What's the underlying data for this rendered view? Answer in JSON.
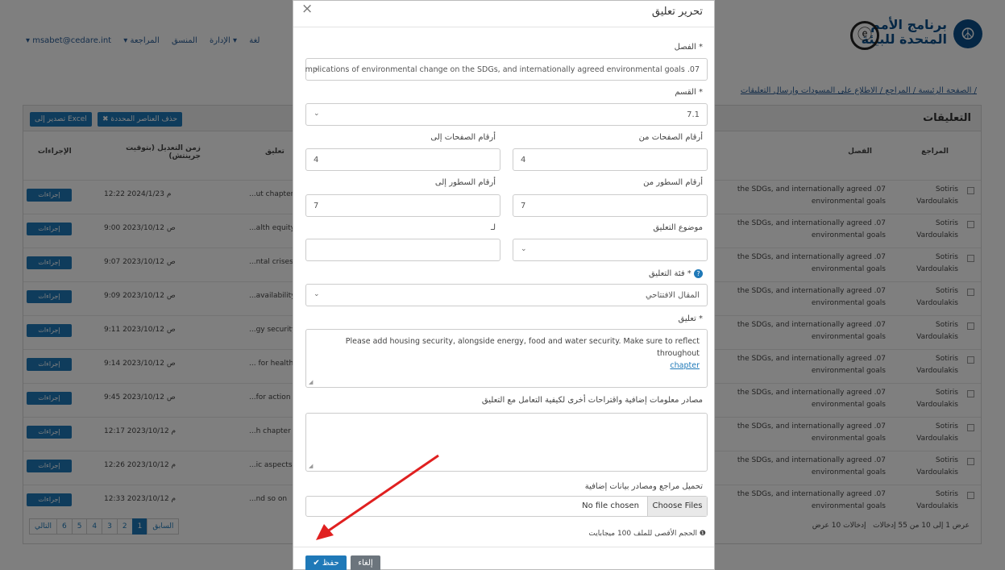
{
  "header": {
    "logo_line1": "برنامج الأمم",
    "logo_line2": "المتحدة للبيئة",
    "user_email": "▾ msabet@cedare.int",
    "nav_items": [
      "▾ لغة",
      "▾ الإدارة",
      "المنسق",
      "المراجعة"
    ],
    "breadcrumb": "الصفحة الرئيسة / المراجع / الاطلاع على المسودات وإرسال التعليقات /"
  },
  "comments_panel": {
    "title": "التعليقات",
    "export_label": "تصدير إلى Excel",
    "delete_selected_label": "✖ حذف العناصر المحددة",
    "col_actions": "الإجراءات",
    "col_modified": "زمن التعديل (بتوقيت جرينتش)",
    "col_comment": "تعليق",
    "col_chapter": "الفصل",
    "col_reviewer": "المراجع",
    "action_label": "إجراءات",
    "rows": [
      {
        "date": "12:22 2024/1/23 م",
        "comment": "...ut chapter",
        "chapter": "the SDGs, and internationally agreed .07 environmental goals",
        "reviewer": "Sotiris Vardoulakis"
      },
      {
        "date": "9:00 2023/10/12 ص",
        "comment": "...alth equity",
        "chapter": "the SDGs, and internationally agreed .07 environmental goals",
        "reviewer": "Sotiris Vardoulakis"
      },
      {
        "date": "9:07 2023/10/12 ص",
        "comment": "...ntal crises",
        "chapter": "the SDGs, and internationally agreed .07 environmental goals",
        "reviewer": "Sotiris Vardoulakis"
      },
      {
        "date": "9:09 2023/10/12 ص",
        "comment": "...availability",
        "chapter": "the SDGs, and internationally agreed .07 environmental goals",
        "reviewer": "Sotiris Vardoulakis"
      },
      {
        "date": "9:11 2023/10/12 ص",
        "comment": "...gy security",
        "chapter": "the SDGs, and internationally agreed .07 environmental goals",
        "reviewer": "Sotiris Vardoulakis"
      },
      {
        "date": "9:14 2023/10/12 ص",
        "comment": "... for health",
        "chapter": "the SDGs, and internationally agreed .07 environmental goals",
        "reviewer": "Sotiris Vardoulakis"
      },
      {
        "date": "9:45 2023/10/12 ص",
        "comment": "...for action",
        "chapter": "the SDGs, and internationally agreed .07 environmental goals",
        "reviewer": "Sotiris Vardoulakis"
      },
      {
        "date": "12:17 2023/10/12 م",
        "comment": "...h chapter",
        "chapter": "the SDGs, and internationally agreed .07 environmental goals",
        "reviewer": "Sotiris Vardoulakis"
      },
      {
        "date": "12:26 2023/10/12 م",
        "comment": "...ic aspects",
        "chapter": "the SDGs, and internationally agreed .07 environmental goals",
        "reviewer": "Sotiris Vardoulakis"
      },
      {
        "date": "12:33 2023/10/12 م",
        "comment": "...nd so on",
        "chapter": "the SDGs, and internationally agreed .07 environmental goals",
        "reviewer": "Sotiris Vardoulakis"
      }
    ],
    "pagination": {
      "prev": "السابق",
      "pages": [
        "1",
        "2",
        "3",
        "4",
        "5",
        "6"
      ],
      "next": "التالي",
      "active": "1"
    },
    "page_info": "عرض 1 إلى 10 من 55 إدخالات",
    "page_size_label": "عرض",
    "page_size": "10",
    "entries_label": "إدخالات"
  },
  "modal": {
    "title": "تحرير تعليق",
    "chapter_label": "الفصل *",
    "chapter_value": "mplications of environmental change on the SDGs, and internationally agreed environmental goals .07",
    "section_label": "القسم *",
    "section_value": "7.1",
    "pages_from_label": "أرقام الصفحات من",
    "pages_from_value": "4",
    "pages_to_label": "أرقام الصفحات إلى",
    "pages_to_value": "4",
    "lines_from_label": "أرقام السطور من",
    "lines_from_value": "7",
    "lines_to_label": "أرقام السطور إلى",
    "lines_to_value": "7",
    "topic_label": "موضوع التعليق",
    "to_label": "لـ",
    "category_label": "فئة التعليق *",
    "category_value": "المقال الافتتاحي",
    "comment_label": "تعليق *",
    "comment_value": "Please add housing security, alongside energy, food and water security. Make sure to reflect throughout",
    "comment_link": "chapter",
    "sources_label": "مصادر معلومات إضافية واقتراحات أخرى لكيفية التعامل مع التعليق",
    "upload_label": "تحميل مراجع ومصادر بيانات إضافية",
    "no_file": "No file chosen",
    "choose_files": "Choose Files",
    "max_size": "الحجم الأقصى للملف 100 ميجابايت",
    "save_label": "✔ حفظ",
    "cancel_label": "إلغاء"
  }
}
